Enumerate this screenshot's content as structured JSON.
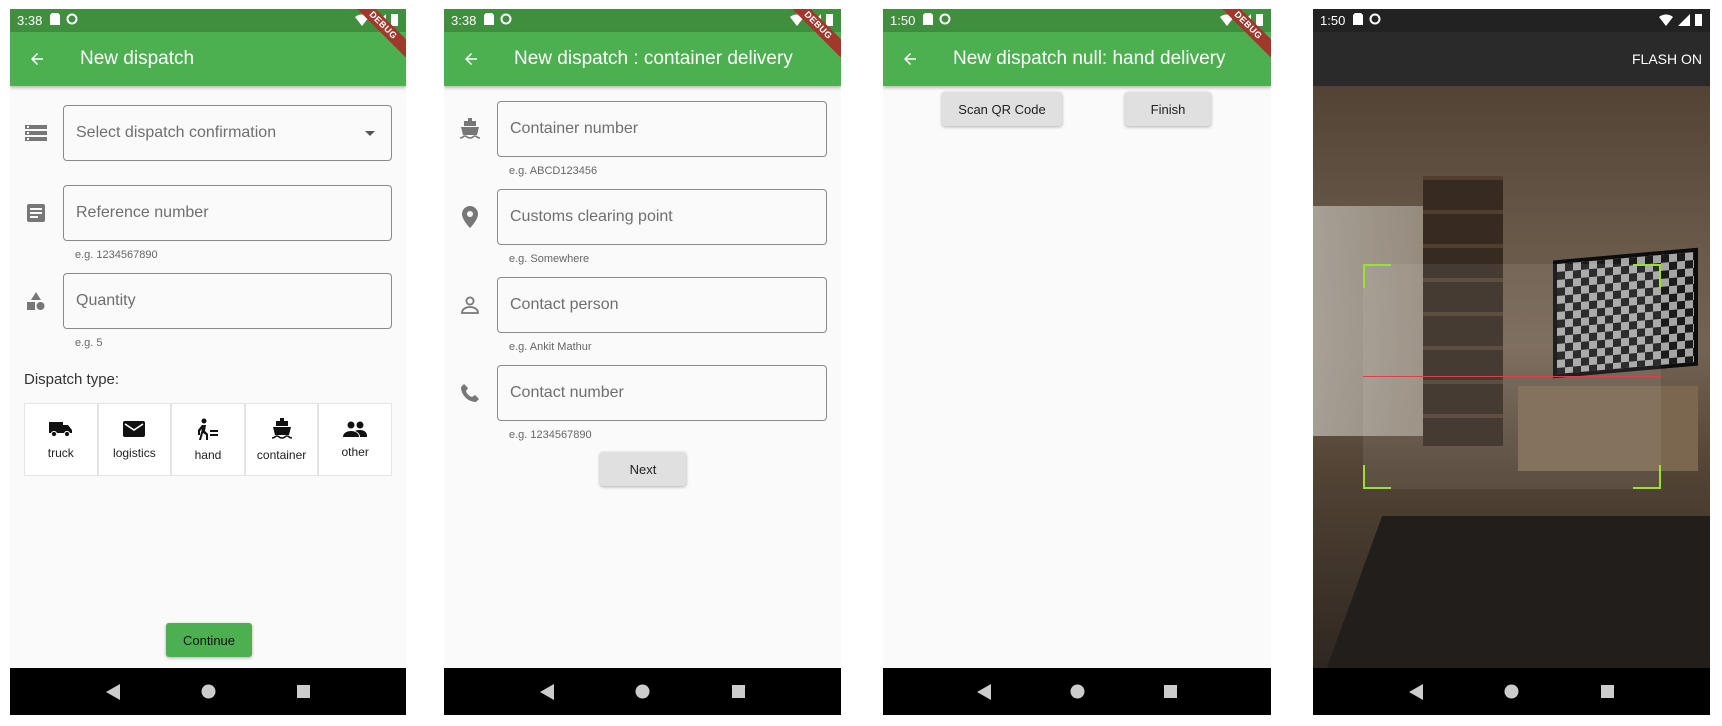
{
  "screens": {
    "s1": {
      "status_time": "3:38",
      "title": "New dispatch",
      "select_placeholder": "Select dispatch confirmation",
      "reference_placeholder": "Reference number",
      "reference_helper": "e.g. 1234567890",
      "quantity_placeholder": "Quantity",
      "quantity_helper": "e.g. 5",
      "dispatch_type_label": "Dispatch type:",
      "dispatch_types": [
        {
          "label": "truck",
          "icon": "truck-icon"
        },
        {
          "label": "logistics",
          "icon": "mail-icon"
        },
        {
          "label": "hand",
          "icon": "hand-delivery-icon"
        },
        {
          "label": "container",
          "icon": "ship-icon"
        },
        {
          "label": "other",
          "icon": "people-icon"
        }
      ],
      "continue_label": "Continue"
    },
    "s2": {
      "status_time": "3:38",
      "title": "New dispatch : container delivery",
      "fields": [
        {
          "placeholder": "Container number",
          "helper": "e.g. ABCD123456",
          "icon": "ship-icon"
        },
        {
          "placeholder": "Customs clearing point",
          "helper": "e.g. Somewhere",
          "icon": "location-icon"
        },
        {
          "placeholder": "Contact person",
          "helper": "e.g. Ankit Mathur",
          "icon": "person-icon"
        },
        {
          "placeholder": "Contact number",
          "helper": "e.g. 1234567890",
          "icon": "phone-icon"
        }
      ],
      "next_label": "Next"
    },
    "s3": {
      "status_time": "1:50",
      "title": "New dispatch null: hand delivery",
      "scan_label": "Scan QR Code",
      "finish_label": "Finish"
    },
    "s4": {
      "status_time": "1:50",
      "flash_label": "FLASH ON"
    }
  },
  "debug_banner": "DEBUG",
  "colors": {
    "appbar": "#4caf50",
    "statusbar": "#3f8f3f",
    "scanner_corner": "#9be22d",
    "scanline": "#e04040"
  }
}
